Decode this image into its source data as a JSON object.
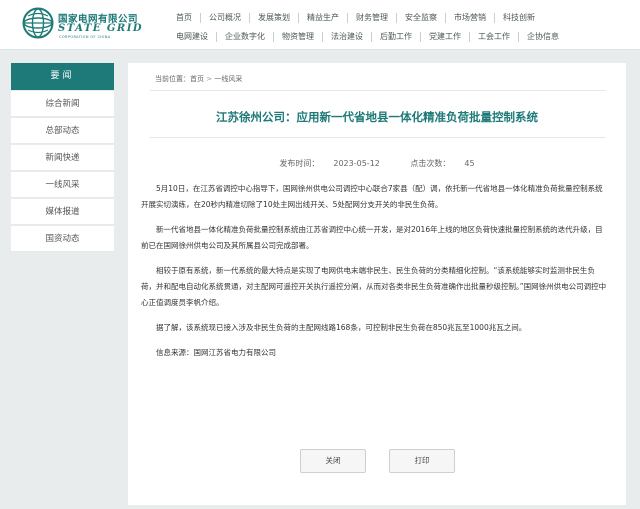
{
  "header": {
    "logo": {
      "cn": "国家电网有限公司",
      "en": "STATE GRID",
      "sub": "CORPORATION OF CHINA"
    },
    "nav_row1": [
      "首页",
      "公司概况",
      "发展策划",
      "精益生产",
      "财务管理",
      "安全监察",
      "市场营销",
      "科技创新"
    ],
    "nav_row2": [
      "电网建设",
      "企业数字化",
      "物资管理",
      "法治建设",
      "后勤工作",
      "党建工作",
      "工会工作",
      "企协信息"
    ]
  },
  "sidebar": {
    "title": "要闻",
    "items": [
      "综合新闻",
      "总部动态",
      "新闻快递",
      "一线风采",
      "媒体报道",
      "国资动态"
    ]
  },
  "article": {
    "breadcrumb": {
      "label": "当前位置：",
      "home": "首页",
      "sep": ">",
      "section": "一线风采"
    },
    "title": "江苏徐州公司：应用新一代省地县一体化精准负荷批量控制系统",
    "publish_label": "发布时间：",
    "publish_date": "2023-05-12",
    "views_label": "点击次数：",
    "views": "45",
    "paragraphs": [
      "5月10日，在江苏省调控中心指导下，国网徐州供电公司调控中心联合7家县（配）调，依托新一代省地县一体化精准负荷批量控制系统开展实切演练，在20秒内精准切除了10处主网出线开关、5处配网分支开关的非民生负荷。",
      "新一代省地县一体化精准负荷批量控制系统由江苏省调控中心统一开发，是对2016年上线的地区负荷快速批量控制系统的迭代升级，目前已在国网徐州供电公司及其所属县公司完成部署。",
      "相较于原有系统，新一代系统的最大特点是实现了电网供电末端非民生、民生负荷的分类精细化控制。“该系统能够实时监测非民生负荷，并和配电自动化系统贯通，对主配网可遥控开关执行遥控分闸，从而对各类非民生负荷准确作出批量秒级控制。”国网徐州供电公司调控中心正值调度员李帆介绍。",
      "据了解，该系统现已接入涉及非民生负荷的主配网线路168条，可控制非民生负荷在850兆瓦至1000兆瓦之间。",
      "信息来源：国网江苏省电力有限公司"
    ]
  },
  "buttons": {
    "close": "关闭",
    "print": "打印"
  },
  "colors": {
    "brand": "#1d7a78",
    "background": "#e9ecec"
  }
}
